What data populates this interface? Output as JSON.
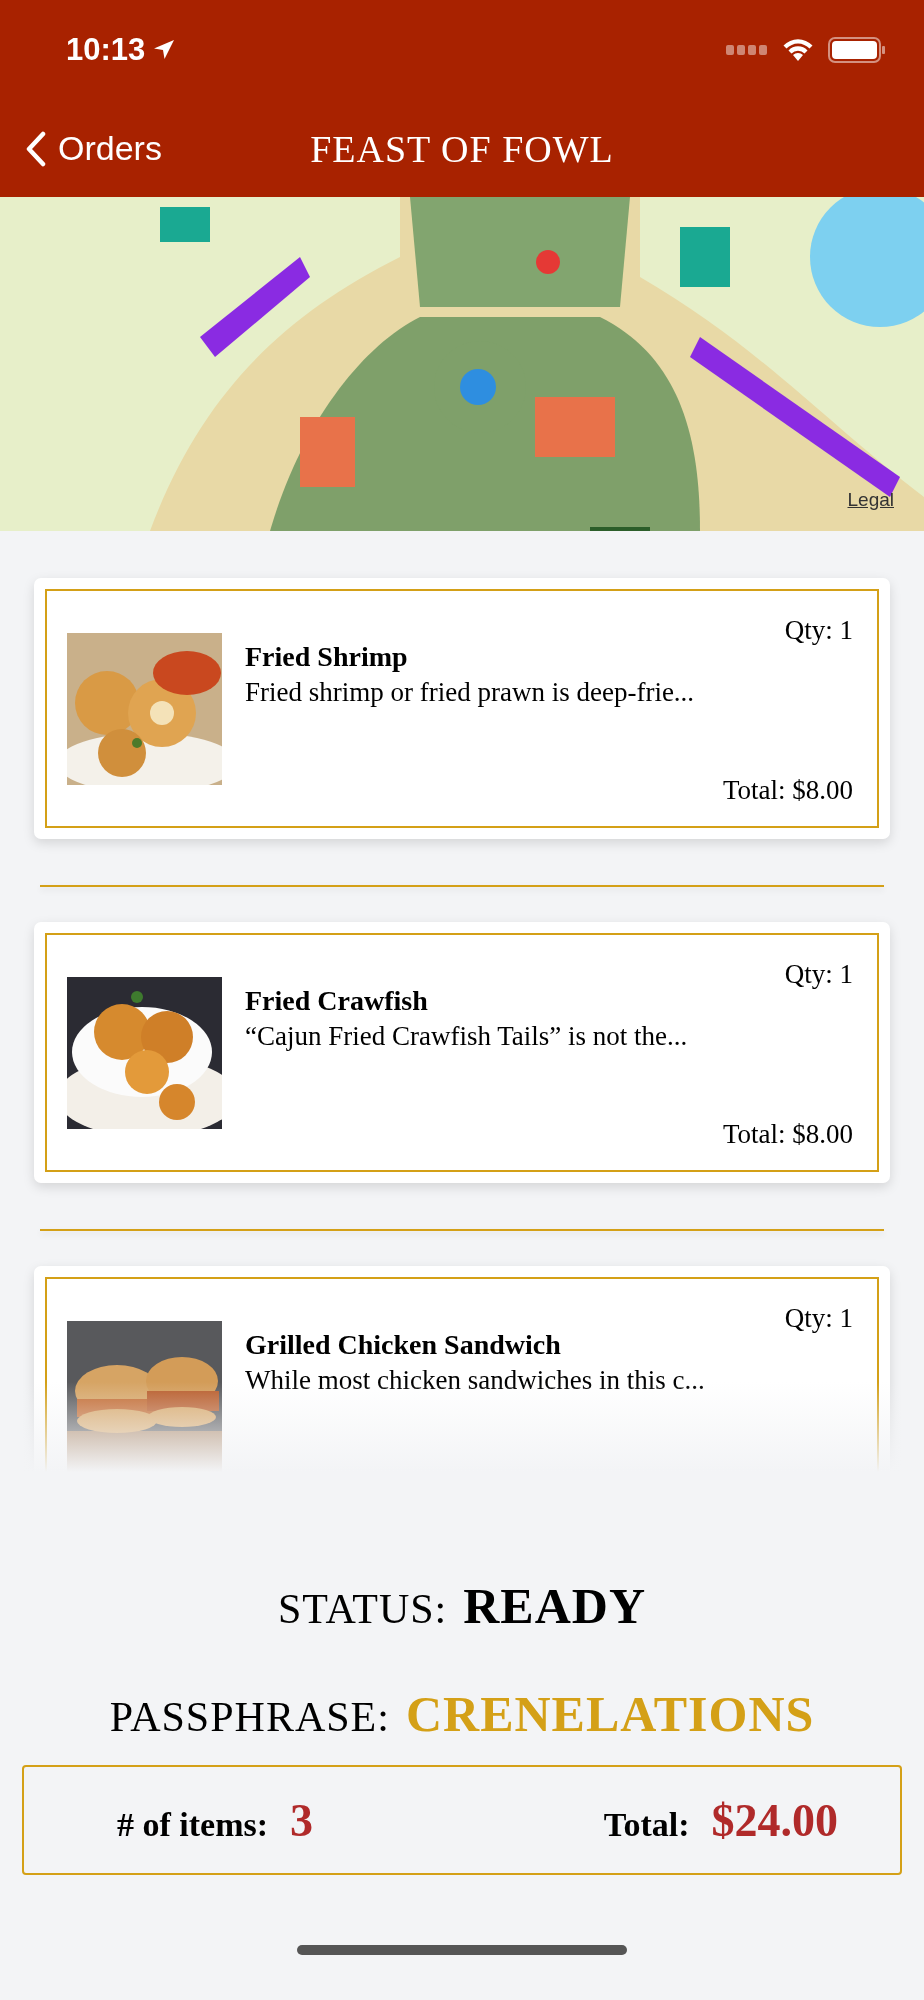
{
  "status_bar": {
    "time": "10:13"
  },
  "nav": {
    "back": "Orders",
    "title": "FEAST OF FOWL"
  },
  "map": {
    "kind": "picture",
    "legal": "Legal"
  },
  "items": [
    {
      "name": "Fried Shrimp",
      "description": "Fried shrimp or fried prawn is deep-frie...",
      "qty": "Qty: 1",
      "total": "Total: $8.00",
      "kind": "picture"
    },
    {
      "name": "Fried Crawfish",
      "description": "“Cajun Fried Crawfish Tails” is not the...",
      "qty": "Qty: 1",
      "total": "Total: $8.00",
      "kind": "picture"
    },
    {
      "name": "Grilled Chicken Sandwich",
      "description": "While most chicken sandwiches in this c...",
      "qty": "Qty: 1",
      "kind": "picture"
    }
  ],
  "status": {
    "label": "STATUS:",
    "value": "READY"
  },
  "passphrase": {
    "label": "PASSPHRASE:",
    "value": "CRENELATIONS"
  },
  "summary": {
    "items_label": "# of items:",
    "items_value": "3",
    "total_label": "Total:",
    "total_value": "$24.00"
  }
}
